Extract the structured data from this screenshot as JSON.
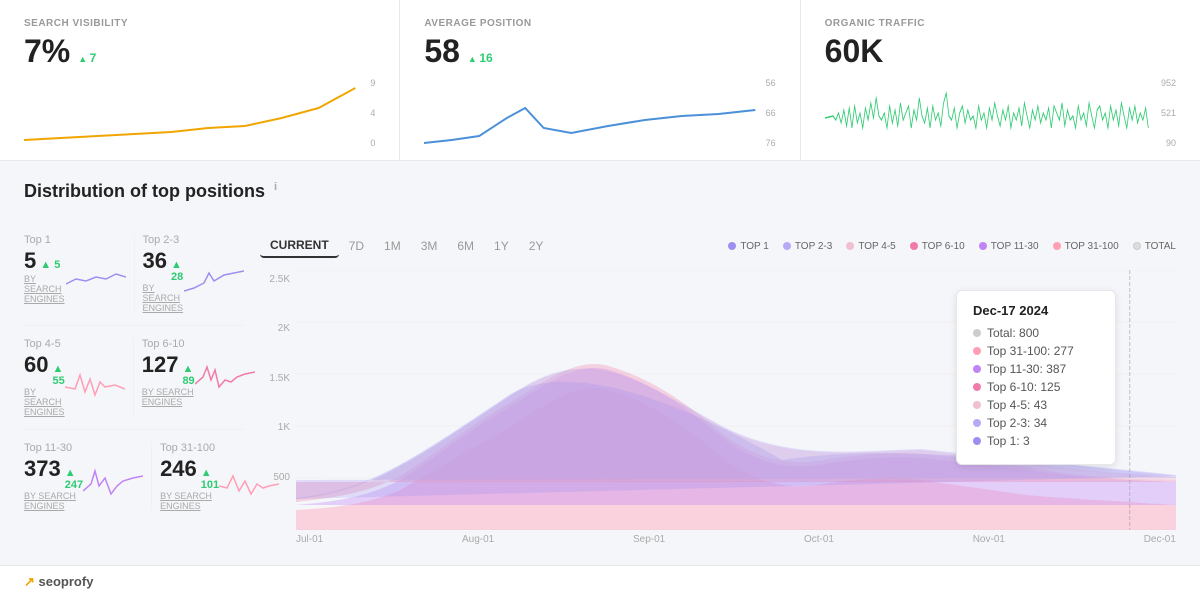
{
  "metrics": {
    "search_visibility": {
      "label": "SEARCH VISIBILITY",
      "value": "7%",
      "change": "7",
      "y_axis": [
        "9",
        "4",
        "0"
      ]
    },
    "average_position": {
      "label": "AVERAGE POSITION",
      "value": "58",
      "change": "16",
      "y_axis": [
        "56",
        "66",
        "76"
      ]
    },
    "organic_traffic": {
      "label": "ORGANIC TRAFFIC",
      "value": "60K",
      "y_axis": [
        "952",
        "521",
        "90"
      ]
    }
  },
  "section_title": "Distribution of top positions",
  "position_cards": [
    {
      "id": "top1",
      "label": "Top 1",
      "value": "5",
      "change": "5",
      "sub": "BY SEARCH ENGINES",
      "color": "#9b8ff0"
    },
    {
      "id": "top4-5",
      "label": "Top 4-5",
      "value": "60",
      "change": "55",
      "sub": "BY SEARCH ENGINES",
      "color": "#ff9eb5"
    },
    {
      "id": "top11-30",
      "label": "Top 11-30",
      "value": "373",
      "change": "247",
      "sub": "BY SEARCH ENGINES",
      "color": "#c6a9f5"
    }
  ],
  "position_cards_right": [
    {
      "id": "top2-3",
      "label": "Top 2-3",
      "value": "36",
      "change": "28",
      "sub": "BY SEARCH ENGINES",
      "color": "#9b8ff0"
    },
    {
      "id": "top6-10",
      "label": "Top 6-10",
      "value": "127",
      "change": "89",
      "sub": "BY SEARCH ENGINES",
      "color": "#f07baa"
    },
    {
      "id": "top31-100",
      "label": "Top 31-100",
      "value": "246",
      "change": "101",
      "sub": "BY SEARCH ENGINES",
      "color": "#ff9eb5"
    }
  ],
  "time_buttons": [
    "CURRENT",
    "7D",
    "1M",
    "3M",
    "6M",
    "1Y",
    "2Y"
  ],
  "active_time": "CURRENT",
  "legend": [
    {
      "label": "TOP 1",
      "color": "#9b8ff0"
    },
    {
      "label": "TOP 2-3",
      "color": "#b8a9f7"
    },
    {
      "label": "TOP 4-5",
      "color": "#f0c0d0"
    },
    {
      "label": "TOP 6-10",
      "color": "#f07baa"
    },
    {
      "label": "TOP 11-30",
      "color": "#c084f5"
    },
    {
      "label": "TOP 31-100",
      "color": "#ff9eb5"
    },
    {
      "label": "TOTAL",
      "color": "#ccc"
    }
  ],
  "tooltip": {
    "date": "Dec-17 2024",
    "rows": [
      {
        "label": "Total: 800",
        "color": "#ccc"
      },
      {
        "label": "Top 31-100: 277",
        "color": "#ff9eb5"
      },
      {
        "label": "Top 11-30: 387",
        "color": "#c084f5"
      },
      {
        "label": "Top 6-10: 125",
        "color": "#f07baa"
      },
      {
        "label": "Top 4-5: 43",
        "color": "#f0c0d0"
      },
      {
        "label": "Top 2-3: 34",
        "color": "#b8a9f7"
      },
      {
        "label": "Top 1: 3",
        "color": "#9b8ff0"
      }
    ]
  },
  "x_axis_labels": [
    "Jul-01",
    "Aug-01",
    "Sep-01",
    "Oct-01",
    "Nov-01",
    "Dec-01"
  ],
  "y_axis_main": [
    "2.5K",
    "2K",
    "1.5K",
    "1K",
    "500"
  ],
  "brand": "seoprofy"
}
